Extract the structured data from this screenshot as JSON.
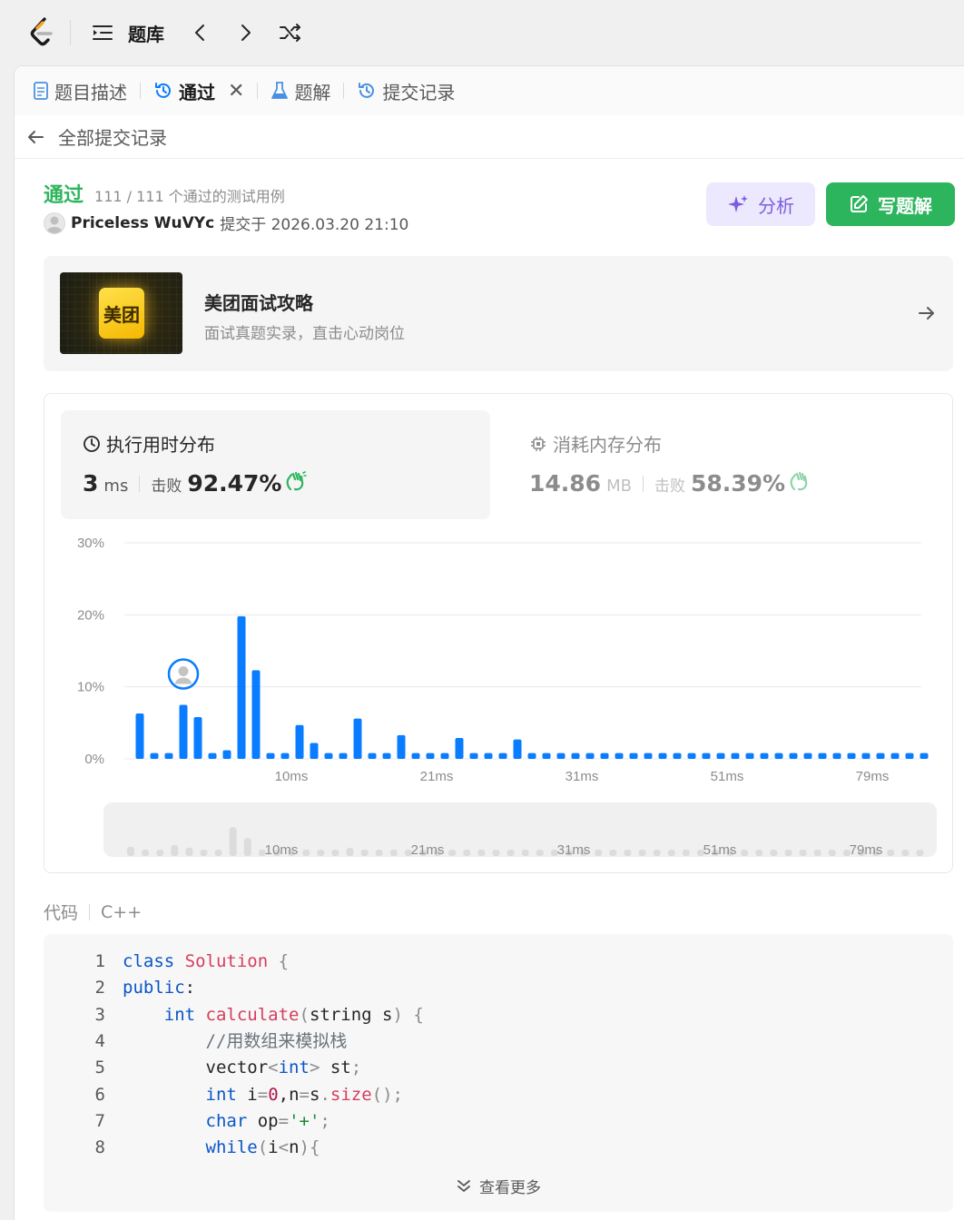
{
  "nav": {
    "title": "题库"
  },
  "tabs": [
    {
      "label": "题目描述"
    },
    {
      "label": "通过"
    },
    {
      "label": "题解"
    },
    {
      "label": "提交记录"
    }
  ],
  "back": {
    "label": "全部提交记录"
  },
  "submission": {
    "status": "通过",
    "cases": "111 / 111 个通过的测试用例",
    "user": "Priceless WuVYc",
    "submitted": "提交于 2026.03.20 21:10"
  },
  "buttons": {
    "analyze": "分析",
    "solution": "写题解"
  },
  "promo": {
    "logo_text": "美团",
    "title": "美团面试攻略",
    "subtitle": "面试真题实录，直击心动岗位"
  },
  "runtime": {
    "title": "执行用时分布",
    "value": "3",
    "unit": "ms",
    "beat_label": "击败",
    "beat": "92.47%"
  },
  "memory": {
    "title": "消耗内存分布",
    "value": "14.86",
    "unit": "MB",
    "beat_label": "击败",
    "beat": "58.39%"
  },
  "colors": {
    "accent_green": "#2db55d",
    "bar_blue": "#0a7cff",
    "analyze_purple": "#7c5ce0"
  },
  "chart_data": {
    "type": "bar",
    "ylabel": "",
    "xlabel": "",
    "ylim": [
      0,
      30
    ],
    "yticks": [
      "30%",
      "20%",
      "10%",
      "0%"
    ],
    "ytick_values": [
      30,
      20,
      10,
      0
    ],
    "xticks": [
      {
        "label": "10ms",
        "index": 10
      },
      {
        "label": "21ms",
        "index": 20
      },
      {
        "label": "31ms",
        "index": 30
      },
      {
        "label": "51ms",
        "index": 40
      },
      {
        "label": "79ms",
        "index": 50
      }
    ],
    "values": [
      6.3,
      0.8,
      0.8,
      7.5,
      5.8,
      0.8,
      1.2,
      19.8,
      12.3,
      0.8,
      0.8,
      4.7,
      2.2,
      0.8,
      0.8,
      5.6,
      0.8,
      0.8,
      3.3,
      0.8,
      0.8,
      0.8,
      2.9,
      0.8,
      0.8,
      0.8,
      2.7,
      0.8,
      0.8,
      0.8,
      0.8,
      0.8,
      0.8,
      0.8,
      0.8,
      0.8,
      0.8,
      0.8,
      0.8,
      0.8,
      0.8,
      0.8,
      0.8,
      0.8,
      0.8,
      0.8,
      0.8,
      0.8,
      0.8,
      0.8,
      0.8,
      0.8,
      0.8,
      0.8,
      0.8
    ],
    "highlight_index": 3,
    "grid": true,
    "minimap": true
  },
  "code": {
    "label": "代码",
    "language": "C++",
    "line_numbers": [
      "1",
      "2",
      "3",
      "4",
      "5",
      "6",
      "7",
      "8"
    ],
    "lines": [
      [
        [
          "kw",
          "class"
        ],
        [
          "",
          " "
        ],
        [
          "fn",
          "Solution"
        ],
        [
          "",
          " "
        ],
        [
          "op",
          "{"
        ]
      ],
      [
        [
          "kw",
          "public"
        ],
        [
          "",
          ":"
        ]
      ],
      [
        [
          "",
          "    "
        ],
        [
          "kw",
          "int"
        ],
        [
          "",
          " "
        ],
        [
          "fn",
          "calculate"
        ],
        [
          "op",
          "("
        ],
        [
          "",
          "string s"
        ],
        [
          "op",
          ")"
        ],
        [
          "",
          " "
        ],
        [
          "op",
          "{"
        ]
      ],
      [
        [
          "",
          "        "
        ],
        [
          "cm",
          "//用数组来模拟栈"
        ]
      ],
      [
        [
          "",
          "        vector"
        ],
        [
          "op",
          "<"
        ],
        [
          "kw",
          "int"
        ],
        [
          "op",
          ">"
        ],
        [
          "",
          " st"
        ],
        [
          "op",
          ";"
        ]
      ],
      [
        [
          "",
          "        "
        ],
        [
          "kw",
          "int"
        ],
        [
          "",
          " i"
        ],
        [
          "op",
          "="
        ],
        [
          "num",
          "0"
        ],
        [
          "",
          ",n"
        ],
        [
          "op",
          "="
        ],
        [
          "",
          "s"
        ],
        [
          "op",
          "."
        ],
        [
          "fn",
          "size"
        ],
        [
          "op",
          "();"
        ]
      ],
      [
        [
          "",
          "        "
        ],
        [
          "kw",
          "char"
        ],
        [
          "",
          " op"
        ],
        [
          "op",
          "="
        ],
        [
          "str",
          "'+'"
        ],
        [
          "op",
          ";"
        ]
      ],
      [
        [
          "",
          "        "
        ],
        [
          "kw",
          "while"
        ],
        [
          "op",
          "("
        ],
        [
          "",
          "i"
        ],
        [
          "op",
          "<"
        ],
        [
          "",
          "n"
        ],
        [
          "op",
          ")"
        ],
        [
          "op",
          "{"
        ]
      ]
    ],
    "more": "查看更多"
  }
}
